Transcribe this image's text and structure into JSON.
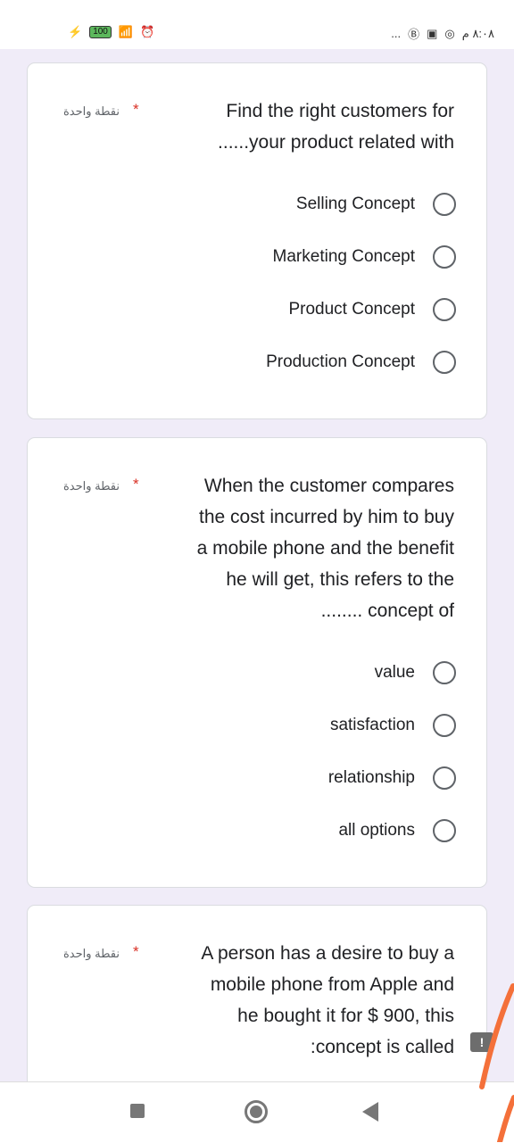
{
  "status_bar": {
    "battery": "100",
    "time": "٨:٠٨ م",
    "more": "..."
  },
  "questions": [
    {
      "points": "نقطة واحدة",
      "required": "*",
      "text": [
        "Find the right customers for",
        "......your product related with"
      ],
      "options": [
        "Selling Concept",
        "Marketing Concept",
        "Product Concept",
        "Production Concept"
      ]
    },
    {
      "points": "نقطة واحدة",
      "required": "*",
      "text": [
        "When the customer compares",
        "the cost incurred by him to buy",
        "a mobile phone and the benefit",
        "he will get, this refers to the",
        "........ concept of"
      ],
      "options": [
        "value",
        "satisfaction",
        "relationship",
        "all options"
      ]
    },
    {
      "points": "نقطة واحدة",
      "required": "*",
      "text": [
        "A person has a desire to buy a",
        "mobile phone from Apple and",
        "he bought it for $ 900, this",
        ":concept is called"
      ],
      "options": []
    }
  ],
  "feedback_badge": "!",
  "colors": {
    "background": "#f0ecf8",
    "required": "#d93025",
    "annotation": "#f4703a"
  }
}
